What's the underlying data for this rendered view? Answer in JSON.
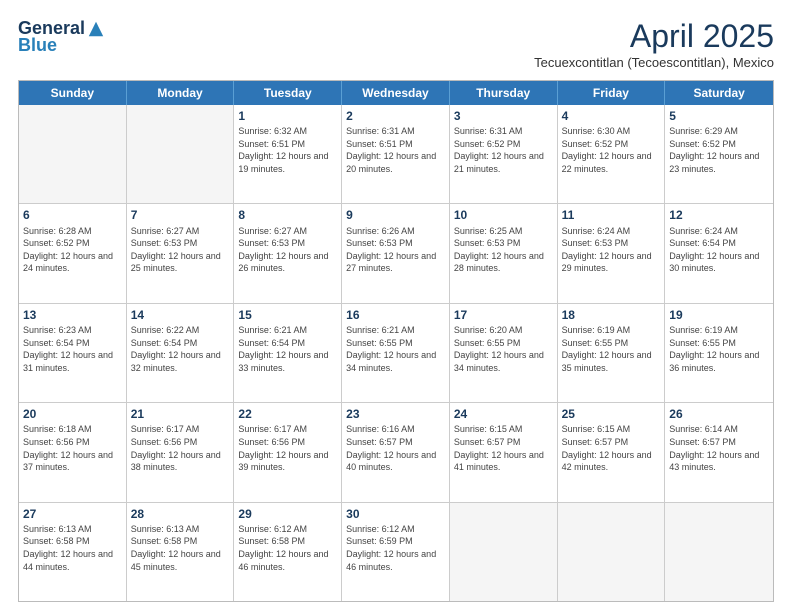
{
  "logo": {
    "general": "General",
    "blue": "Blue"
  },
  "title": "April 2025",
  "location": "Tecuexcontitlan (Tecoescontitlan), Mexico",
  "days_of_week": [
    "Sunday",
    "Monday",
    "Tuesday",
    "Wednesday",
    "Thursday",
    "Friday",
    "Saturday"
  ],
  "weeks": [
    [
      {
        "day": "",
        "sunrise": "",
        "sunset": "",
        "daylight": "",
        "empty": true
      },
      {
        "day": "",
        "sunrise": "",
        "sunset": "",
        "daylight": "",
        "empty": true
      },
      {
        "day": "1",
        "sunrise": "Sunrise: 6:32 AM",
        "sunset": "Sunset: 6:51 PM",
        "daylight": "Daylight: 12 hours and 19 minutes."
      },
      {
        "day": "2",
        "sunrise": "Sunrise: 6:31 AM",
        "sunset": "Sunset: 6:51 PM",
        "daylight": "Daylight: 12 hours and 20 minutes."
      },
      {
        "day": "3",
        "sunrise": "Sunrise: 6:31 AM",
        "sunset": "Sunset: 6:52 PM",
        "daylight": "Daylight: 12 hours and 21 minutes."
      },
      {
        "day": "4",
        "sunrise": "Sunrise: 6:30 AM",
        "sunset": "Sunset: 6:52 PM",
        "daylight": "Daylight: 12 hours and 22 minutes."
      },
      {
        "day": "5",
        "sunrise": "Sunrise: 6:29 AM",
        "sunset": "Sunset: 6:52 PM",
        "daylight": "Daylight: 12 hours and 23 minutes."
      }
    ],
    [
      {
        "day": "6",
        "sunrise": "Sunrise: 6:28 AM",
        "sunset": "Sunset: 6:52 PM",
        "daylight": "Daylight: 12 hours and 24 minutes."
      },
      {
        "day": "7",
        "sunrise": "Sunrise: 6:27 AM",
        "sunset": "Sunset: 6:53 PM",
        "daylight": "Daylight: 12 hours and 25 minutes."
      },
      {
        "day": "8",
        "sunrise": "Sunrise: 6:27 AM",
        "sunset": "Sunset: 6:53 PM",
        "daylight": "Daylight: 12 hours and 26 minutes."
      },
      {
        "day": "9",
        "sunrise": "Sunrise: 6:26 AM",
        "sunset": "Sunset: 6:53 PM",
        "daylight": "Daylight: 12 hours and 27 minutes."
      },
      {
        "day": "10",
        "sunrise": "Sunrise: 6:25 AM",
        "sunset": "Sunset: 6:53 PM",
        "daylight": "Daylight: 12 hours and 28 minutes."
      },
      {
        "day": "11",
        "sunrise": "Sunrise: 6:24 AM",
        "sunset": "Sunset: 6:53 PM",
        "daylight": "Daylight: 12 hours and 29 minutes."
      },
      {
        "day": "12",
        "sunrise": "Sunrise: 6:24 AM",
        "sunset": "Sunset: 6:54 PM",
        "daylight": "Daylight: 12 hours and 30 minutes."
      }
    ],
    [
      {
        "day": "13",
        "sunrise": "Sunrise: 6:23 AM",
        "sunset": "Sunset: 6:54 PM",
        "daylight": "Daylight: 12 hours and 31 minutes."
      },
      {
        "day": "14",
        "sunrise": "Sunrise: 6:22 AM",
        "sunset": "Sunset: 6:54 PM",
        "daylight": "Daylight: 12 hours and 32 minutes."
      },
      {
        "day": "15",
        "sunrise": "Sunrise: 6:21 AM",
        "sunset": "Sunset: 6:54 PM",
        "daylight": "Daylight: 12 hours and 33 minutes."
      },
      {
        "day": "16",
        "sunrise": "Sunrise: 6:21 AM",
        "sunset": "Sunset: 6:55 PM",
        "daylight": "Daylight: 12 hours and 34 minutes."
      },
      {
        "day": "17",
        "sunrise": "Sunrise: 6:20 AM",
        "sunset": "Sunset: 6:55 PM",
        "daylight": "Daylight: 12 hours and 34 minutes."
      },
      {
        "day": "18",
        "sunrise": "Sunrise: 6:19 AM",
        "sunset": "Sunset: 6:55 PM",
        "daylight": "Daylight: 12 hours and 35 minutes."
      },
      {
        "day": "19",
        "sunrise": "Sunrise: 6:19 AM",
        "sunset": "Sunset: 6:55 PM",
        "daylight": "Daylight: 12 hours and 36 minutes."
      }
    ],
    [
      {
        "day": "20",
        "sunrise": "Sunrise: 6:18 AM",
        "sunset": "Sunset: 6:56 PM",
        "daylight": "Daylight: 12 hours and 37 minutes."
      },
      {
        "day": "21",
        "sunrise": "Sunrise: 6:17 AM",
        "sunset": "Sunset: 6:56 PM",
        "daylight": "Daylight: 12 hours and 38 minutes."
      },
      {
        "day": "22",
        "sunrise": "Sunrise: 6:17 AM",
        "sunset": "Sunset: 6:56 PM",
        "daylight": "Daylight: 12 hours and 39 minutes."
      },
      {
        "day": "23",
        "sunrise": "Sunrise: 6:16 AM",
        "sunset": "Sunset: 6:57 PM",
        "daylight": "Daylight: 12 hours and 40 minutes."
      },
      {
        "day": "24",
        "sunrise": "Sunrise: 6:15 AM",
        "sunset": "Sunset: 6:57 PM",
        "daylight": "Daylight: 12 hours and 41 minutes."
      },
      {
        "day": "25",
        "sunrise": "Sunrise: 6:15 AM",
        "sunset": "Sunset: 6:57 PM",
        "daylight": "Daylight: 12 hours and 42 minutes."
      },
      {
        "day": "26",
        "sunrise": "Sunrise: 6:14 AM",
        "sunset": "Sunset: 6:57 PM",
        "daylight": "Daylight: 12 hours and 43 minutes."
      }
    ],
    [
      {
        "day": "27",
        "sunrise": "Sunrise: 6:13 AM",
        "sunset": "Sunset: 6:58 PM",
        "daylight": "Daylight: 12 hours and 44 minutes."
      },
      {
        "day": "28",
        "sunrise": "Sunrise: 6:13 AM",
        "sunset": "Sunset: 6:58 PM",
        "daylight": "Daylight: 12 hours and 45 minutes."
      },
      {
        "day": "29",
        "sunrise": "Sunrise: 6:12 AM",
        "sunset": "Sunset: 6:58 PM",
        "daylight": "Daylight: 12 hours and 46 minutes."
      },
      {
        "day": "30",
        "sunrise": "Sunrise: 6:12 AM",
        "sunset": "Sunset: 6:59 PM",
        "daylight": "Daylight: 12 hours and 46 minutes."
      },
      {
        "day": "",
        "sunrise": "",
        "sunset": "",
        "daylight": "",
        "empty": true
      },
      {
        "day": "",
        "sunrise": "",
        "sunset": "",
        "daylight": "",
        "empty": true
      },
      {
        "day": "",
        "sunrise": "",
        "sunset": "",
        "daylight": "",
        "empty": true
      }
    ]
  ]
}
